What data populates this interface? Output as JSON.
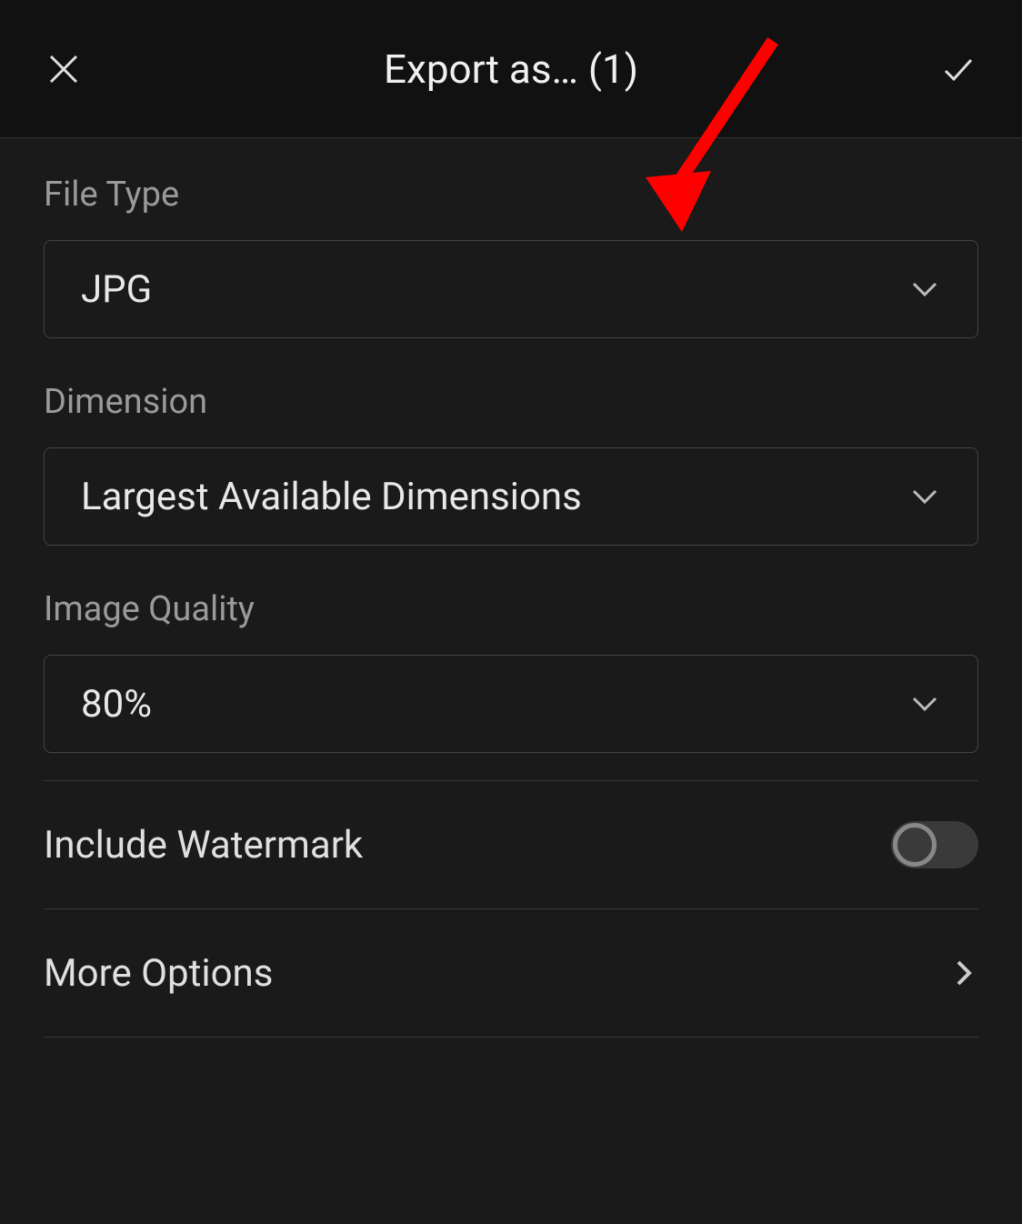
{
  "header": {
    "title": "Export as… (1)"
  },
  "fields": {
    "fileType": {
      "label": "File Type",
      "value": "JPG"
    },
    "dimension": {
      "label": "Dimension",
      "value": "Largest Available Dimensions"
    },
    "imageQuality": {
      "label": "Image Quality",
      "value": "80%"
    }
  },
  "rows": {
    "watermark": {
      "label": "Include Watermark",
      "enabled": false
    },
    "moreOptions": {
      "label": "More Options"
    }
  }
}
